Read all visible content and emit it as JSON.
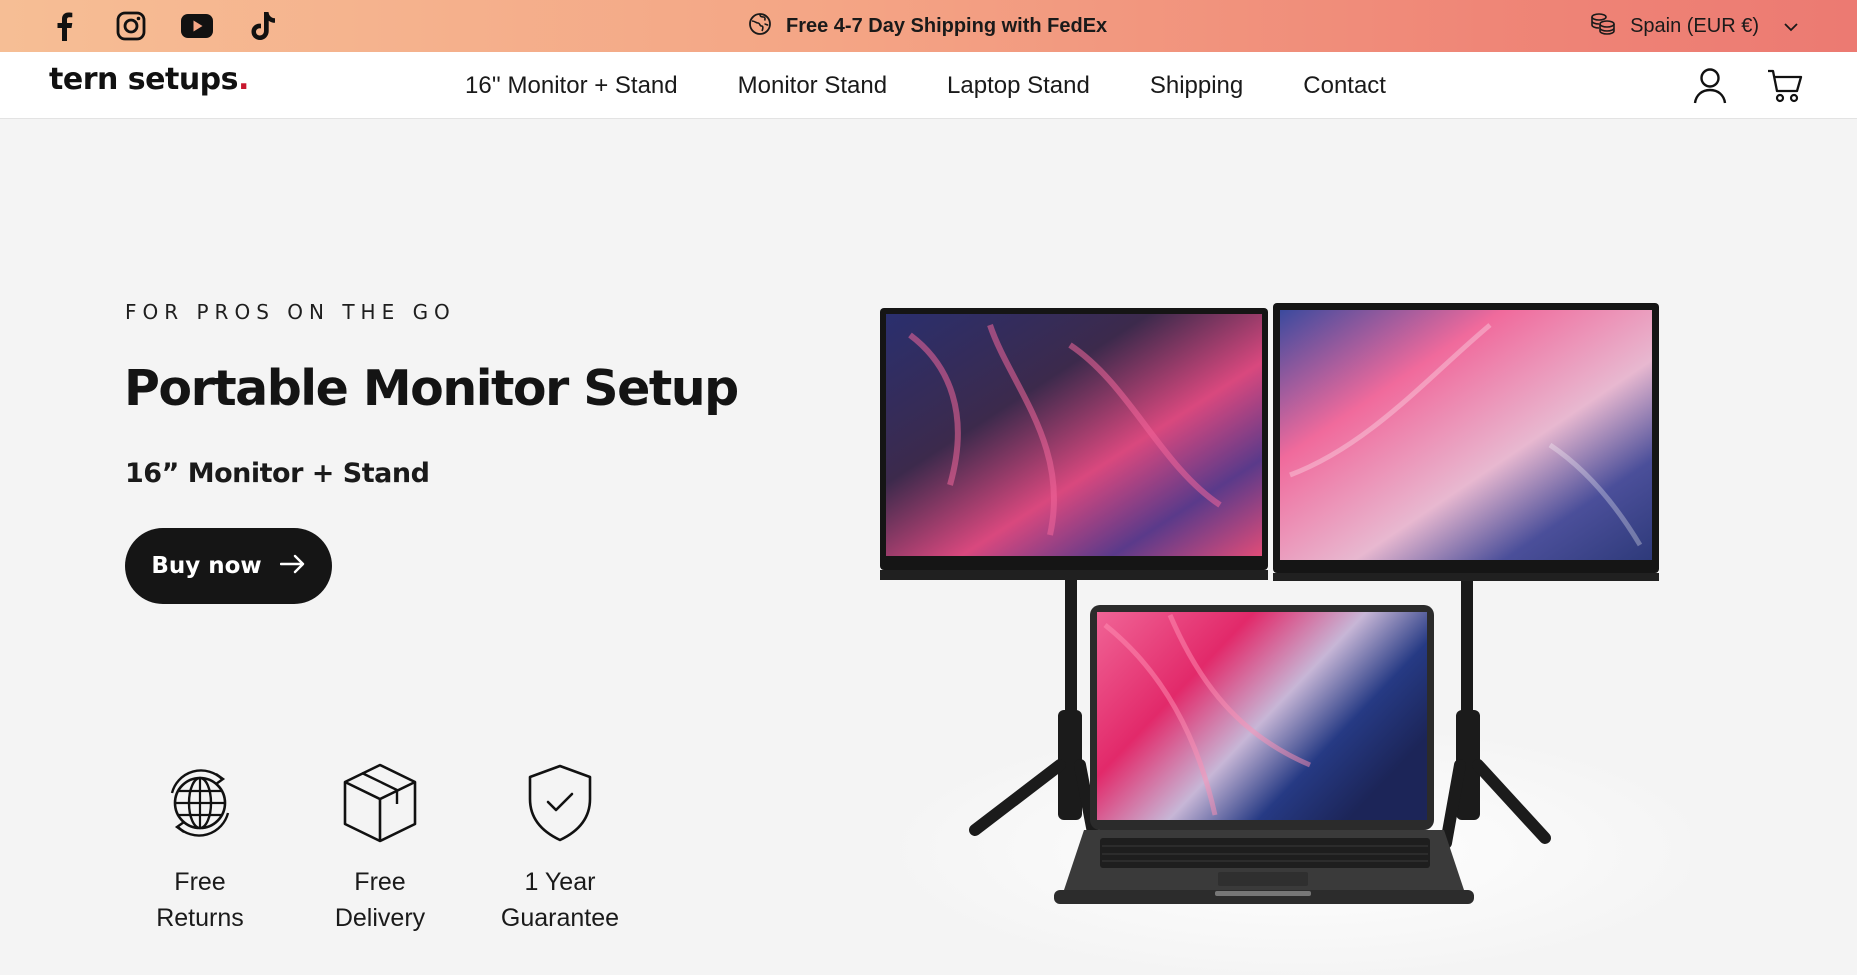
{
  "announcement": {
    "social": [
      "facebook-icon",
      "instagram-icon",
      "youtube-icon",
      "tiktok-icon"
    ],
    "text": "Free 4-7 Day Shipping with FedEx",
    "icon": "globe-shipping-icon"
  },
  "locale": {
    "label": "Spain (EUR €)",
    "icon": "coins-icon"
  },
  "header": {
    "logo_text": "tern setups",
    "logo_dot": ".",
    "nav": [
      "16'' Monitor + Stand",
      "Monitor Stand",
      "Laptop Stand",
      "Shipping",
      "Contact"
    ],
    "account_icon": "user-icon",
    "cart_icon": "cart-icon"
  },
  "hero": {
    "eyebrow": "FOR PROS ON THE GO",
    "title": "Portable Monitor Setup",
    "subtitle": "16” Monitor + Stand",
    "cta": "Buy now",
    "image": "dual-portable-monitors-with-laptop"
  },
  "features": [
    {
      "line1": "Free",
      "line2": "Returns",
      "icon": "globe-returns-icon"
    },
    {
      "line1": "Free",
      "line2": "Delivery",
      "icon": "package-icon"
    },
    {
      "line1": "1 Year",
      "line2": "Guarantee",
      "icon": "shield-check-icon"
    }
  ],
  "colors": {
    "brand_dot": "#c8182e",
    "bar_start": "#f6be95",
    "bar_end": "#ec7a72",
    "button": "#151515"
  }
}
